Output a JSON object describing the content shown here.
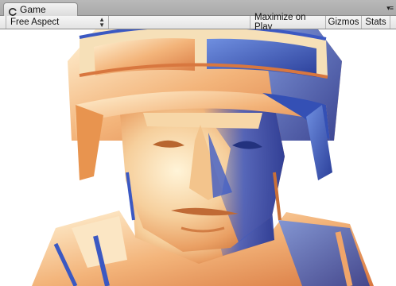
{
  "tab": {
    "label": "Game",
    "icon": "unity-logo-icon",
    "menu_icon": "tab-menu-icon"
  },
  "toolbar": {
    "aspect_label": "Free Aspect",
    "maximize_label": "Maximize on Play",
    "gizmos_label": "Gizmos",
    "stats_label": "Stats"
  },
  "viewport": {
    "content": "3d-soldier-render",
    "colors": {
      "warm": "#f0a56a",
      "cool": "#3f63c9",
      "highlight": "#fbefd0"
    }
  }
}
